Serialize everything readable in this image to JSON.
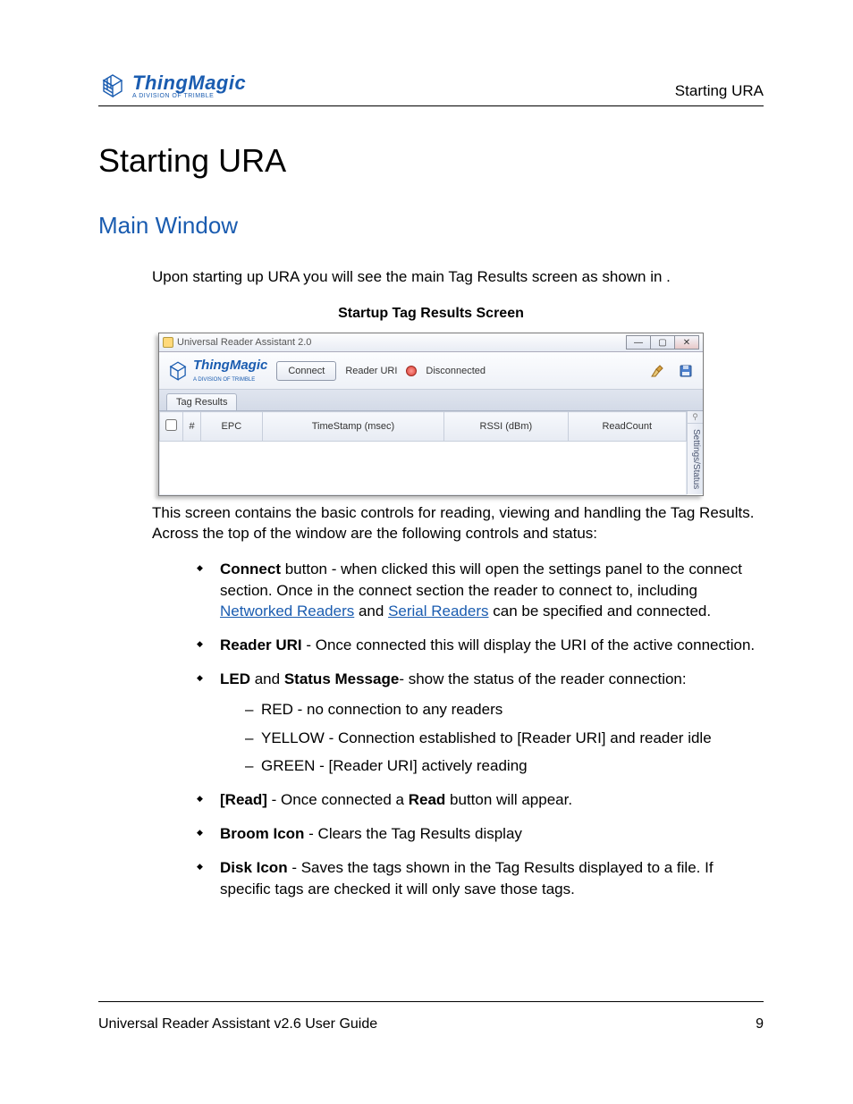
{
  "header": {
    "brand": "ThingMagic",
    "tagline": "A DIVISION OF TRIMBLE",
    "breadcrumb": "Starting URA"
  },
  "page_title": "Starting URA",
  "section_title": "Main Window",
  "intro": "Upon starting up URA you will see the main Tag Results screen as shown in ",
  "intro_trail": ".",
  "figure": {
    "caption": "Startup Tag Results Screen",
    "window_title": "Universal Reader Assistant 2.0",
    "toolbar": {
      "brand": "ThingMagic",
      "tagline": "A DIVISION OF TRIMBLE",
      "connect_label": "Connect",
      "uri_label": "Reader URI",
      "status_text": "Disconnected"
    },
    "tab_label": "Tag Results",
    "columns": [
      "#",
      "EPC",
      "TimeStamp (msec)",
      "RSSI (dBm)",
      "ReadCount"
    ],
    "side_panel_label": "Settings/Status"
  },
  "desc": "This screen contains the basic controls for reading, viewing and handling the Tag Results. Across the top of the window are the following controls and status:",
  "bullets": {
    "connect": {
      "label": "Connect",
      "text1": " button - when clicked this will open the settings panel to the connect section. Once in the connect section the reader to connect to, including ",
      "link1": "Networked Readers",
      "text2": " and ",
      "link2": "Serial Readers",
      "text3": " can be specified and connected."
    },
    "reader_uri": {
      "label": "Reader URI",
      "text": " - Once connected this will display the URI of the active connection."
    },
    "led": {
      "label1": "LED",
      "mid": " and ",
      "label2": "Status Message",
      "text": "- show the status of the reader connection:",
      "items": [
        "RED - no connection to any readers",
        "YELLOW - Connection established to [Reader URI] and reader idle",
        "GREEN - [Reader URI] actively reading"
      ]
    },
    "read": {
      "label": "[Read]",
      "text1": " - Once connected a ",
      "bold": "Read",
      "text2": " button will appear."
    },
    "broom": {
      "label": "Broom Icon",
      "text": " - Clears the Tag Results display"
    },
    "disk": {
      "label": "Disk Icon",
      "text": " - Saves the tags shown in the Tag Results displayed to a file. If specific tags are checked it will only save those tags."
    }
  },
  "footer": {
    "left": "Universal Reader Assistant v2.6 User Guide",
    "right": "9"
  }
}
